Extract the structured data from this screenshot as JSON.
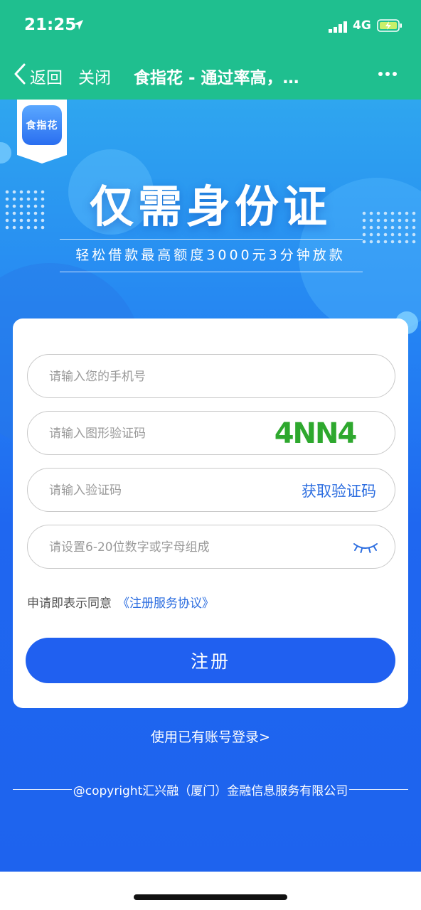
{
  "status_bar": {
    "time": "21:25",
    "network": "4G"
  },
  "nav": {
    "back_label": "返回",
    "close_label": "关闭",
    "title": "食指花 - 通过率高，…"
  },
  "brand": {
    "logo_text": "食指花"
  },
  "hero": {
    "title": "仅需身份证",
    "subtitle": "轻松借款最高额度3000元3分钟放款"
  },
  "form": {
    "phone_placeholder": "请输入您的手机号",
    "captcha_placeholder": "请输入图形验证码",
    "captcha_text": "4NN4",
    "sms_placeholder": "请输入验证码",
    "get_code_label": "获取验证码",
    "password_placeholder": "请设置6-20位数字或字母组成",
    "agree_prefix": "申请即表示同意",
    "agree_link": "《注册服务协议》",
    "register_label": "注册"
  },
  "footer": {
    "login_link": "使用已有账号登录>",
    "copyright": "@copyright汇兴融（厦门）金融信息服务有限公司"
  },
  "colors": {
    "nav_green": "#1fbf8f",
    "primary_blue": "#2060f0",
    "link_blue": "#2d6ee0",
    "captcha_green": "#2ea82e"
  }
}
